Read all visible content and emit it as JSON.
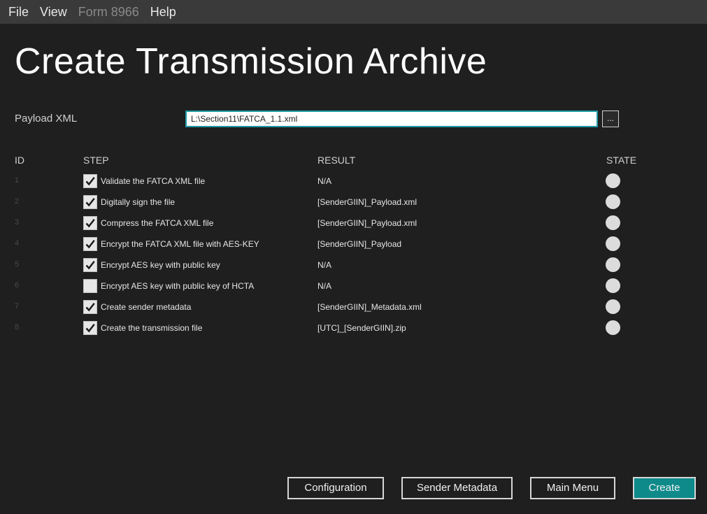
{
  "menubar": {
    "items": [
      {
        "label": "File",
        "enabled": true
      },
      {
        "label": "View",
        "enabled": true
      },
      {
        "label": "Form 8966",
        "enabled": false
      },
      {
        "label": "Help",
        "enabled": true
      }
    ]
  },
  "page": {
    "title": "Create Transmission Archive"
  },
  "payload": {
    "label": "Payload XML",
    "value": "L:\\Section11\\FATCA_1.1.xml",
    "browse_label": "..."
  },
  "table": {
    "headers": {
      "id": "ID",
      "step": "STEP",
      "result": "RESULT",
      "state": "STATE"
    },
    "rows": [
      {
        "id": "1",
        "checked": true,
        "step": "Validate the FATCA XML file",
        "result": "N/A"
      },
      {
        "id": "2",
        "checked": true,
        "step": "Digitally sign the file",
        "result": "[SenderGIIN]_Payload.xml"
      },
      {
        "id": "3",
        "checked": true,
        "step": "Compress the FATCA XML file",
        "result": "[SenderGIIN]_Payload.xml"
      },
      {
        "id": "4",
        "checked": true,
        "step": "Encrypt the FATCA XML file with AES-KEY",
        "result": "[SenderGIIN]_Payload"
      },
      {
        "id": "5",
        "checked": true,
        "step": "Encrypt AES key with public key",
        "result": "N/A"
      },
      {
        "id": "6",
        "checked": false,
        "step": "Encrypt AES key with public key of HCTA",
        "result": "N/A"
      },
      {
        "id": "7",
        "checked": true,
        "step": "Create sender metadata",
        "result": "[SenderGIIN]_Metadata.xml"
      },
      {
        "id": "8",
        "checked": true,
        "step": "Create the transmission file",
        "result": "[UTC]_[SenderGIIN].zip"
      }
    ]
  },
  "footer": {
    "configuration_label": "Configuration",
    "sender_metadata_label": "Sender Metadata",
    "main_menu_label": "Main Menu",
    "create_label": "Create"
  },
  "colors": {
    "background": "#1f1f1f",
    "menubar": "#3a3a3a",
    "accent": "#0e8a8a",
    "input_border": "#1e9aa5"
  }
}
